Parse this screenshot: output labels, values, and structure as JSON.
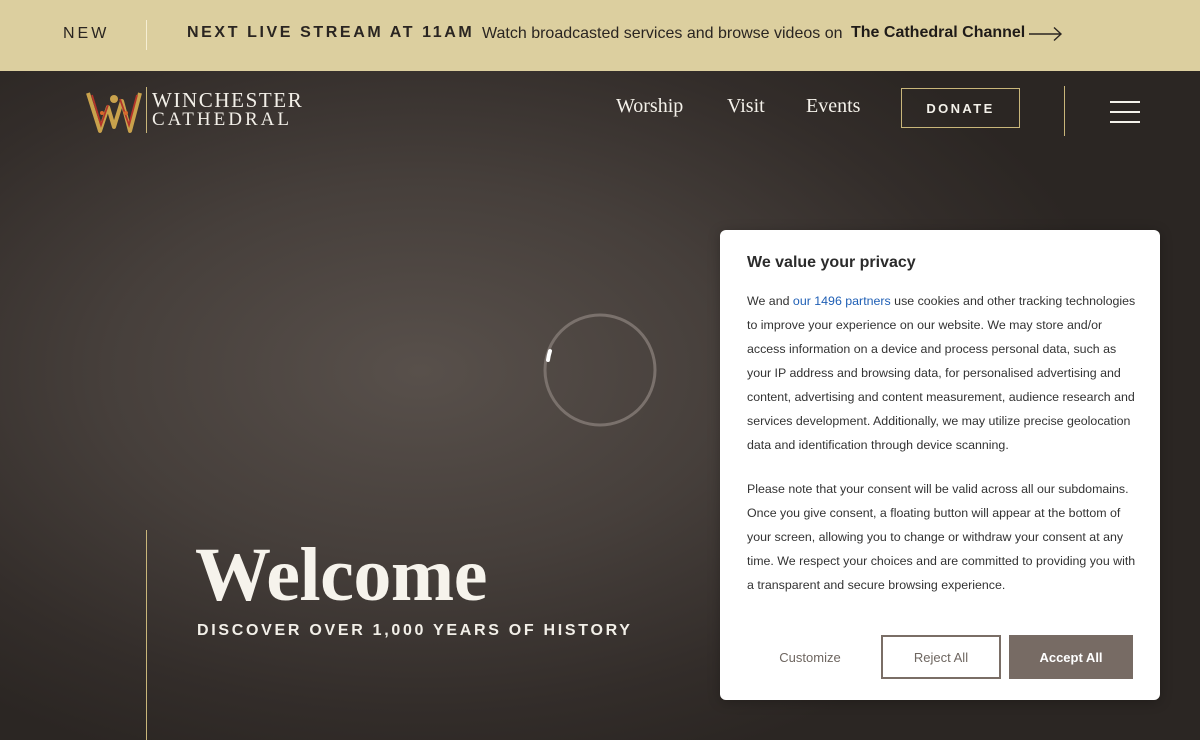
{
  "announcement": {
    "new_label": "NEW",
    "stream_label": "NEXT LIVE STREAM AT 11AM",
    "message": "Watch broadcasted services and browse videos on",
    "channel_link": "The Cathedral Channel"
  },
  "logo": {
    "line1": "WINCHESTER",
    "line2": "CATHEDRAL"
  },
  "nav": {
    "worship": "Worship",
    "visit": "Visit",
    "events": "Events",
    "donate": "DONATE"
  },
  "hero": {
    "title": "Welcome",
    "tagline": "DISCOVER OVER 1,000 YEARS OF HISTORY"
  },
  "privacy": {
    "title": "We value your privacy",
    "p1_before": "We and ",
    "p1_link": "our 1496 partners",
    "p1_after": " use cookies and other tracking technologies to improve your experience on our website. We may store and/or access information on a device and process personal data, such as your IP address and browsing data, for personalised advertising and content, advertising and content measurement, audience research and services development. Additionally, we may utilize precise geolocation data and identification through device scanning.",
    "p2": "Please note that your consent will be valid across all our subdomains. Once you give consent, a floating button will appear at the bottom of your screen, allowing you to change or withdraw your consent at any time. We respect your choices and are committed to providing you with a transparent and secure browsing experience.",
    "customize": "Customize",
    "reject": "Reject All",
    "accept": "Accept All"
  },
  "colors": {
    "announce_bg": "#dccf9f",
    "gold_accent": "#c9b67a",
    "accept_bg": "#776b64",
    "link": "#1f5fb5"
  },
  "icons": [
    "arrow-right-icon",
    "menu-icon",
    "loading-spinner-icon",
    "logo-mark-icon"
  ]
}
